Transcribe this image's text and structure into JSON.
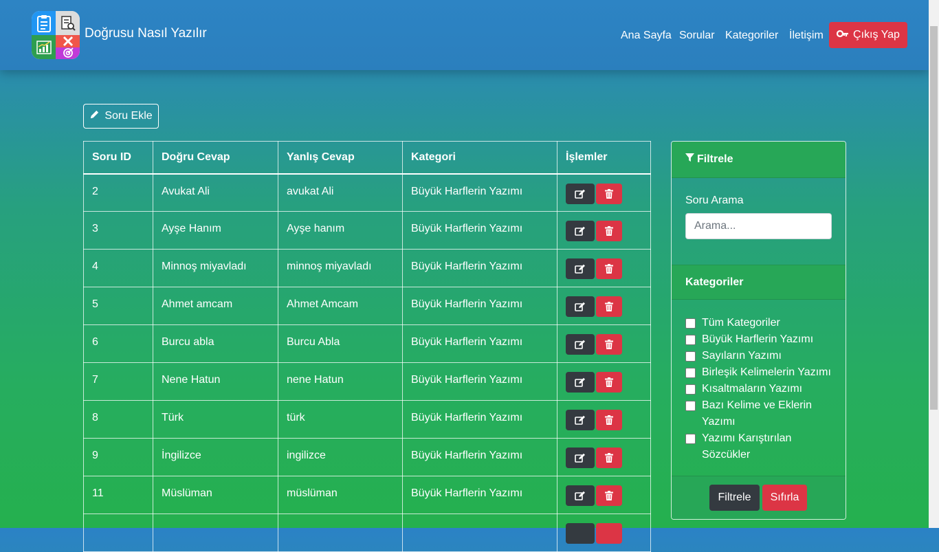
{
  "nav": {
    "brand": "Doğrusu Nasıl Yazılır",
    "links": [
      "Ana Sayfa",
      "Sorular",
      "Kategoriler",
      "İletişim"
    ],
    "logout": "Çıkış Yap"
  },
  "main": {
    "add_button": "Soru Ekle",
    "table": {
      "headers": [
        "Soru ID",
        "Doğru Cevap",
        "Yanlış Cevap",
        "Kategori",
        "İşlemler"
      ],
      "rows": [
        {
          "id": "2",
          "correct": "Avukat Ali",
          "wrong": "avukat Ali",
          "category": "Büyük Harflerin Yazımı"
        },
        {
          "id": "3",
          "correct": "Ayşe Hanım",
          "wrong": "Ayşe hanım",
          "category": "Büyük Harflerin Yazımı"
        },
        {
          "id": "4",
          "correct": "Minnoş miyavladı",
          "wrong": "minnoş miyavladı",
          "category": "Büyük Harflerin Yazımı"
        },
        {
          "id": "5",
          "correct": "Ahmet amcam",
          "wrong": "Ahmet Amcam",
          "category": "Büyük Harflerin Yazımı"
        },
        {
          "id": "6",
          "correct": "Burcu abla",
          "wrong": "Burcu Abla",
          "category": "Büyük Harflerin Yazımı"
        },
        {
          "id": "7",
          "correct": "Nene Hatun",
          "wrong": "nene Hatun",
          "category": "Büyük Harflerin Yazımı"
        },
        {
          "id": "8",
          "correct": "Türk",
          "wrong": "türk",
          "category": "Büyük Harflerin Yazımı"
        },
        {
          "id": "9",
          "correct": "İngilizce",
          "wrong": "ingilizce",
          "category": "Büyük Harflerin Yazımı"
        },
        {
          "id": "11",
          "correct": "Müslüman",
          "wrong": "müslüman",
          "category": "Büyük Harflerin Yazımı"
        }
      ]
    }
  },
  "filter": {
    "title": "Filtrele",
    "search_label": "Soru Arama",
    "search_placeholder": "Arama...",
    "search_value": "",
    "categories_title": "Kategoriler",
    "categories": [
      "Tüm Kategoriler",
      "Büyük Harflerin Yazımı",
      "Sayıların Yazımı",
      "Birleşik Kelimelerin Yazımı",
      "Kısaltmaların Yazımı",
      "Bazı Kelime ve Eklerin Yazımı",
      "Yazımı Karıştırılan Sözcükler"
    ],
    "filter_button": "Filtrele",
    "reset_button": "Sıfırla"
  },
  "colors": {
    "danger": "#dc3545",
    "dark": "#343a40",
    "primary_nav": "#2b82c6",
    "success": "#27a757"
  }
}
